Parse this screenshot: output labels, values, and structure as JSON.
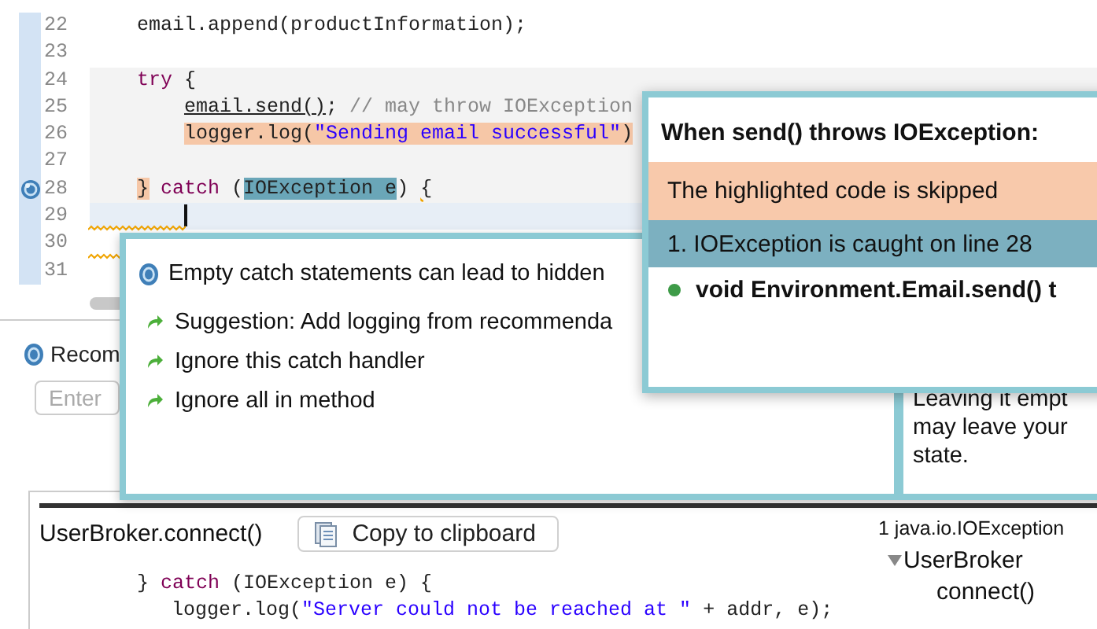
{
  "editor": {
    "lines": [
      {
        "number": "22",
        "kind": "outer",
        "in_try": false,
        "current": false,
        "warning": false,
        "marker": false,
        "segments": [
          {
            "text": "email.append(productInformation);",
            "kind": "plain"
          }
        ]
      },
      {
        "number": "23",
        "kind": "outer",
        "in_try": false,
        "current": false,
        "warning": false,
        "marker": false
      },
      {
        "number": "24",
        "kind": "outer",
        "in_try": true,
        "current": false,
        "warning": false,
        "marker": false,
        "segments": [
          {
            "text": "try",
            "kind": "keyword"
          },
          {
            "text": " {",
            "kind": "plain"
          }
        ]
      },
      {
        "number": "25",
        "kind": "inner",
        "in_try": true,
        "current": false,
        "warning": false,
        "marker": false,
        "segments": [
          {
            "text": "email.send()",
            "kind": "call"
          },
          {
            "text": ";",
            "kind": "plain"
          },
          {
            "text": " // may throw IOException",
            "kind": "comment"
          }
        ]
      },
      {
        "number": "26",
        "kind": "inner",
        "in_try": true,
        "current": false,
        "warning": false,
        "marker": false,
        "segments": [
          {
            "text": "logger.log(",
            "kind": "skipped"
          },
          {
            "text": "\"Sending email successful\"",
            "kind": "skipped_string"
          },
          {
            "text": ")",
            "kind": "skipped"
          }
        ]
      },
      {
        "number": "27",
        "kind": "outer",
        "in_try": true,
        "current": false,
        "warning": false,
        "marker": false
      },
      {
        "number": "28",
        "kind": "outer",
        "in_try": true,
        "current": false,
        "warning": false,
        "marker": true,
        "segments": [
          {
            "text": "}",
            "kind": "skipped"
          },
          {
            "text": " catch",
            "kind": "keyword"
          },
          {
            "text": " (",
            "kind": "plain"
          },
          {
            "text": "IOException e",
            "kind": "caught"
          },
          {
            "text": ") ",
            "kind": "plain"
          },
          {
            "text": "{",
            "kind": "warning"
          }
        ]
      },
      {
        "number": "29",
        "kind": "inner",
        "in_try": false,
        "current": true,
        "warning": true,
        "marker": false
      },
      {
        "number": "30",
        "kind": "outer",
        "in_try": false,
        "current": false,
        "warning": true,
        "marker": false
      },
      {
        "number": "31",
        "kind": "outer",
        "in_try": false,
        "current": false,
        "warning": false,
        "marker": false
      }
    ]
  },
  "quick_fix_popup": {
    "title": "Empty catch statements can lead to hidden",
    "items": [
      {
        "label": "Suggestion: Add logging from recommenda"
      },
      {
        "label": "Ignore this catch handler"
      },
      {
        "label": "Ignore all in method"
      }
    ],
    "details": [
      "Leaving it empt",
      "may leave your",
      "state."
    ]
  },
  "exception_popup": {
    "title": "When send() throws IOException:",
    "rows": [
      {
        "kind": "skipped",
        "text": "The highlighted code is skipped"
      },
      {
        "kind": "caught",
        "text": "1.  IOException is caught on line 28"
      },
      {
        "kind": "method",
        "text": "void Environment.Email.send() t"
      }
    ]
  },
  "recommendations_view": {
    "tab_label": "Recom",
    "search": {
      "placeholder": "Enter"
    },
    "snippet": {
      "title": "UserBroker.connect()",
      "copy_button": "Copy to clipboard",
      "lines": [
        {
          "kind": "outer",
          "segments": [
            {
              "text": "}",
              "kind": "plain"
            },
            {
              "text": " catch",
              "kind": "keyword"
            },
            {
              "text": " (IOException e) {",
              "kind": "plain"
            }
          ]
        },
        {
          "kind": "inner",
          "segments": [
            {
              "text": "logger.log(",
              "kind": "plain"
            },
            {
              "text": "\"Server could not be reached at \"",
              "kind": "string"
            },
            {
              "text": " + addr, e);",
              "kind": "plain"
            }
          ]
        }
      ]
    },
    "trace": {
      "header": "1 java.io.IOException",
      "items": [
        {
          "label": "UserBroker",
          "expanded": true,
          "children": [
            {
              "label": "connect()"
            }
          ]
        }
      ]
    }
  }
}
